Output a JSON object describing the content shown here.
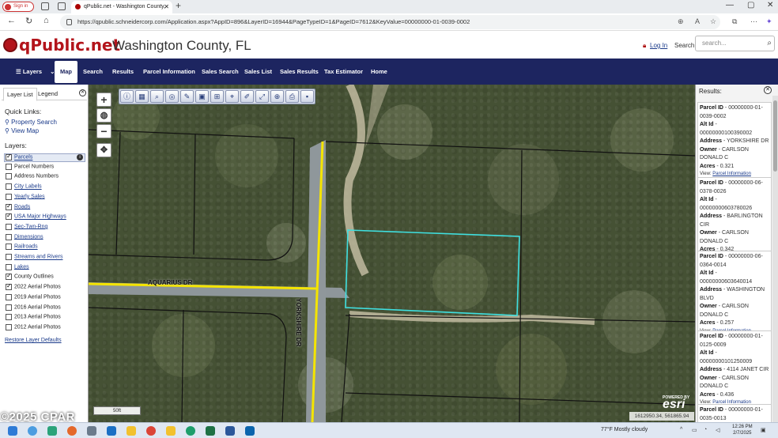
{
  "browser": {
    "signin_label": "Sign in",
    "tab_title": "qPublic.net - Washington County,",
    "url": "https://qpublic.schneidercorp.com/Application.aspx?AppID=896&LayerID=16944&PageTypeID=1&PageID=7612&KeyValue=00000000-01-0039-0002"
  },
  "site": {
    "logo_text": "qPublic.net",
    "county_title": "Washington County, FL",
    "login_label": "Log In",
    "search_label": "Search",
    "search_placeholder": "search..."
  },
  "nav": {
    "layers": "Layers",
    "map": "Map",
    "search": "Search",
    "results": "Results",
    "parcel_information": "Parcel Information",
    "sales_search": "Sales Search",
    "sales_list": "Sales List",
    "sales_results": "Sales Results",
    "tax_estimator": "Tax Estimator",
    "home": "Home"
  },
  "left_panel": {
    "tab_layer_list": "Layer List",
    "tab_legend": "Legend",
    "quick_links_title": "Quick Links:",
    "quick_links": [
      "Property Search",
      "View Map"
    ],
    "layers_title": "Layers:",
    "layers": [
      {
        "label": "Parcels",
        "checked": true,
        "link": true
      },
      {
        "label": "Parcel Numbers",
        "checked": false,
        "link": false
      },
      {
        "label": "Address Numbers",
        "checked": false,
        "link": false
      },
      {
        "label": "City Labels",
        "checked": false,
        "link": true
      },
      {
        "label": "Yearly Sales",
        "checked": false,
        "link": true
      },
      {
        "label": "Roads",
        "checked": true,
        "link": true
      },
      {
        "label": "USA Major Highways",
        "checked": true,
        "link": true
      },
      {
        "label": "Sec-Twn-Rng",
        "checked": false,
        "link": true
      },
      {
        "label": "Dimensions",
        "checked": false,
        "link": true
      },
      {
        "label": "Railroads",
        "checked": false,
        "link": true
      },
      {
        "label": "Streams and Rivers",
        "checked": false,
        "link": true
      },
      {
        "label": "Lakes",
        "checked": false,
        "link": true
      },
      {
        "label": "County Outlines",
        "checked": true,
        "link": false
      },
      {
        "label": "2022 Aerial Photos",
        "checked": true,
        "link": false
      },
      {
        "label": "2019 Aerial Photos",
        "checked": false,
        "link": false
      },
      {
        "label": "2016 Aerial Photos",
        "checked": false,
        "link": false
      },
      {
        "label": "2013 Aerial Photos",
        "checked": false,
        "link": false
      },
      {
        "label": "2012 Aerial Photos",
        "checked": false,
        "link": false
      }
    ],
    "restore_label": "Restore Layer Defaults"
  },
  "map": {
    "road_labels": [
      "AQUARIUS DR",
      "YORKSHIRE DR"
    ],
    "scale_label": "50ft",
    "coordinates": "1612950.34, 561865.94",
    "esri_powered": "POWERED BY",
    "esri_logo": "esri",
    "watermark": "©2025 CPAR"
  },
  "results": {
    "title": "Results:",
    "view_prefix": "View:",
    "view_link": "Parcel Information",
    "items": [
      {
        "parcel_id": "00000000-01-0039-0002",
        "alt_id": "00000000100390002",
        "address": "YORKSHIRE DR",
        "owner": "CARLSON DONALD C",
        "acres": "0.321"
      },
      {
        "parcel_id": "00000000-06-0378-0026",
        "alt_id": "00000000603780026",
        "address": "BARLINGTON CIR",
        "owner": "CARLSON DONALD C",
        "acres": "0.342"
      },
      {
        "parcel_id": "00000000-06-0364-0014",
        "alt_id": "00000000603640014",
        "address": "WASHINGTON BLVD",
        "owner": "CARLSON DONALD C",
        "acres": "0.257"
      },
      {
        "parcel_id": "00000000-01-0125-0009",
        "alt_id": "00000000101250009",
        "address": "4114 JANET CIR",
        "owner": "CARLSON DONALD C",
        "acres": "0.436"
      },
      {
        "parcel_id": "00000000-01-0035-0013"
      }
    ]
  },
  "taskbar": {
    "weather": "77°F  Mostly cloudy",
    "time": "12:26 PM",
    "date": "2/7/2025"
  }
}
